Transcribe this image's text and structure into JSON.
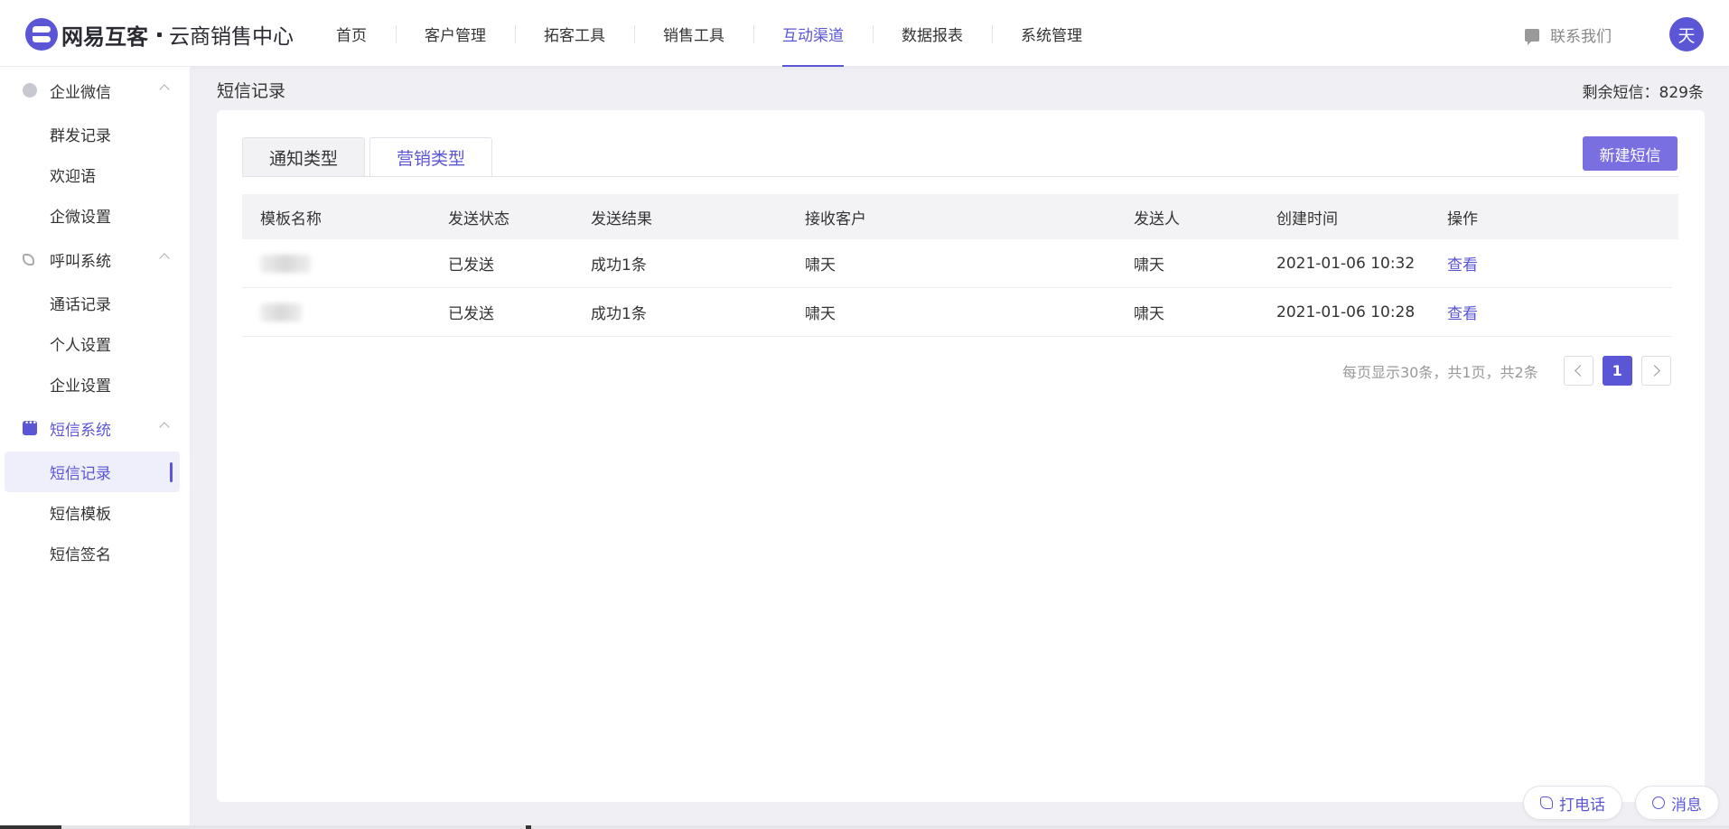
{
  "header": {
    "logo_brand": "网易互客",
    "logo_sub": "云商销售中心",
    "nav": [
      "首页",
      "客户管理",
      "拓客工具",
      "销售工具",
      "互动渠道",
      "数据报表",
      "系统管理"
    ],
    "active_nav": "互动渠道",
    "contact_label": "联系我们",
    "avatar_text": "天"
  },
  "sidebar": {
    "groups": [
      {
        "label": "企业微信",
        "icon": "wechat-icon",
        "items": [
          "群发记录",
          "欢迎语",
          "企微设置"
        ]
      },
      {
        "label": "呼叫系统",
        "icon": "phone-icon",
        "items": [
          "通话记录",
          "个人设置",
          "企业设置"
        ]
      },
      {
        "label": "短信系统",
        "icon": "sms-icon",
        "items": [
          "短信记录",
          "短信模板",
          "短信签名"
        ]
      }
    ],
    "active_item": "短信记录"
  },
  "main": {
    "page_title": "短信记录",
    "sms_left": "剩余短信：829条",
    "tabs": [
      "通知类型",
      "营销类型"
    ],
    "active_tab": "营销类型",
    "new_button": "新建短信",
    "table": {
      "columns": [
        "模板名称",
        "发送状态",
        "发送结果",
        "接收客户",
        "发送人",
        "创建时间",
        "操作"
      ],
      "rows": [
        {
          "name": "",
          "status": "已发送",
          "result": "成功1条",
          "customer": "啸天",
          "sender": "啸天",
          "created": "2021-01-06 10:32",
          "action": "查看"
        },
        {
          "name": "",
          "status": "已发送",
          "result": "成功1条",
          "customer": "啸天",
          "sender": "啸天",
          "created": "2021-01-06 10:28",
          "action": "查看"
        }
      ]
    },
    "pagination": {
      "info": "每页显示30条，共1页，共2条",
      "current_page": "1"
    }
  },
  "floating": {
    "call_label": "打电话",
    "message_label": "消息"
  },
  "colors": {
    "accent": "#5a56d6",
    "button": "#7a6fe0"
  }
}
